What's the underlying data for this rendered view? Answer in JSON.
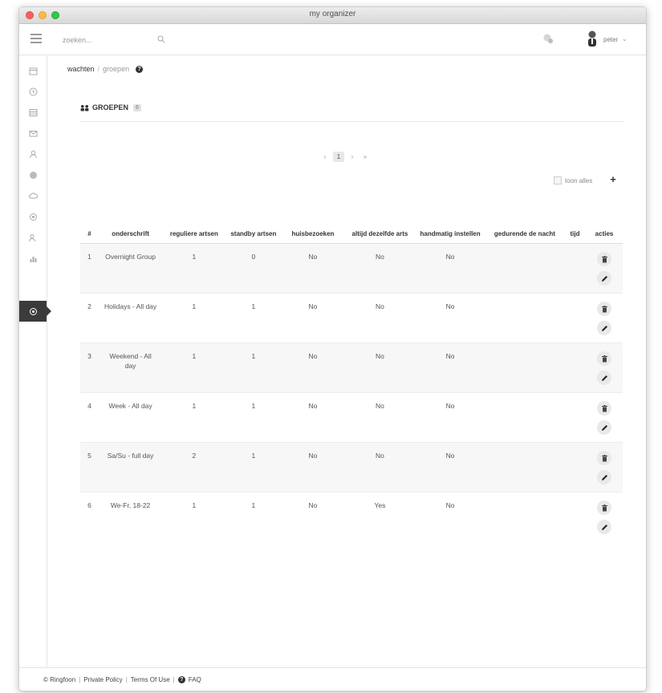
{
  "window": {
    "title": "my organizer"
  },
  "topbar": {
    "search_placeholder": "zoeken...",
    "user_name": "peter",
    "user_caret": "⌄"
  },
  "sidebar": {
    "items": [
      {
        "icon": "calendar-icon"
      },
      {
        "icon": "clock-icon"
      },
      {
        "icon": "list-icon"
      },
      {
        "icon": "mail-icon"
      },
      {
        "icon": "user-icon"
      },
      {
        "icon": "globe-icon"
      },
      {
        "icon": "cloud-icon"
      },
      {
        "icon": "settings-icon"
      },
      {
        "icon": "users-icon"
      },
      {
        "icon": "chart-icon"
      },
      {
        "icon": "groups-icon",
        "active": true
      }
    ]
  },
  "breadcrumb": {
    "root": "wachten",
    "separator": "/",
    "current": "groepen"
  },
  "section": {
    "title": "GROEPEN",
    "count": "6"
  },
  "pagination": {
    "prev": "‹",
    "page": "1",
    "next": "›",
    "last": "»"
  },
  "toolbar": {
    "select_all_label": "toon alles",
    "add_label": "+"
  },
  "table": {
    "headers": {
      "index": "#",
      "caption": "onderschrift",
      "regular": "reguliere artsen",
      "standby": "standby artsen",
      "house": "huisbezoeken",
      "same": "altijd dezelfde arts",
      "manual": "handmatig instellen",
      "night": "gedurende de nacht",
      "time": "tijd",
      "actions": "acties"
    },
    "rows": [
      {
        "index": "1",
        "caption": "Overnight Group",
        "regular": "1",
        "standby": "0",
        "house": "No",
        "same": "No",
        "manual": "No",
        "night": "",
        "time": ""
      },
      {
        "index": "2",
        "caption": "Holidays - All day",
        "regular": "1",
        "standby": "1",
        "house": "No",
        "same": "No",
        "manual": "No",
        "night": "",
        "time": ""
      },
      {
        "index": "3",
        "caption": "Weekend - All day",
        "regular": "1",
        "standby": "1",
        "house": "No",
        "same": "No",
        "manual": "No",
        "night": "",
        "time": ""
      },
      {
        "index": "4",
        "caption": "Week - All day",
        "regular": "1",
        "standby": "1",
        "house": "No",
        "same": "No",
        "manual": "No",
        "night": "",
        "time": ""
      },
      {
        "index": "5",
        "caption": "Sa/Su - full day",
        "regular": "2",
        "standby": "1",
        "house": "No",
        "same": "No",
        "manual": "No",
        "night": "",
        "time": ""
      },
      {
        "index": "6",
        "caption": "We-Fr, 18-22",
        "regular": "1",
        "standby": "1",
        "house": "No",
        "same": "Yes",
        "manual": "No",
        "night": "",
        "time": ""
      }
    ]
  },
  "footer": {
    "copyright": "© Ringfoon",
    "privacy": "Private Policy",
    "terms": "Terms Of Use",
    "faq": "FAQ",
    "pipe": "|"
  },
  "colors": {
    "accent_dark": "#3b3b3b",
    "row_alt": "#f7f7f7",
    "border": "#e4e4e4"
  }
}
